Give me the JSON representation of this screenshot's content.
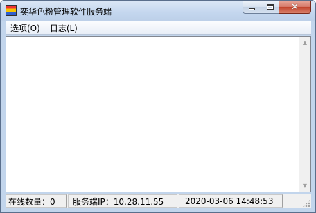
{
  "window": {
    "title": "奕华色粉管理软件服务端",
    "controls": {
      "minimize_glyph": "",
      "maximize_glyph": "",
      "close_glyph": "✕"
    }
  },
  "menu": {
    "items": [
      {
        "label": "选项(O)"
      },
      {
        "label": "日志(L)"
      }
    ]
  },
  "content": {
    "log_text": ""
  },
  "status": {
    "online_count": "在线数量：0",
    "server_ip": "服务端IP：10.28.11.55",
    "datetime": "2020-03-06 14:48:53"
  },
  "icons": {
    "app": "app-icon",
    "scroll_up": "scroll-up-arrow-icon",
    "scroll_down": "scroll-down-arrow-icon"
  },
  "colors": {
    "title_bar": "#c2d5ec",
    "close_button": "#c2442d",
    "border": "#5a6f8c"
  }
}
